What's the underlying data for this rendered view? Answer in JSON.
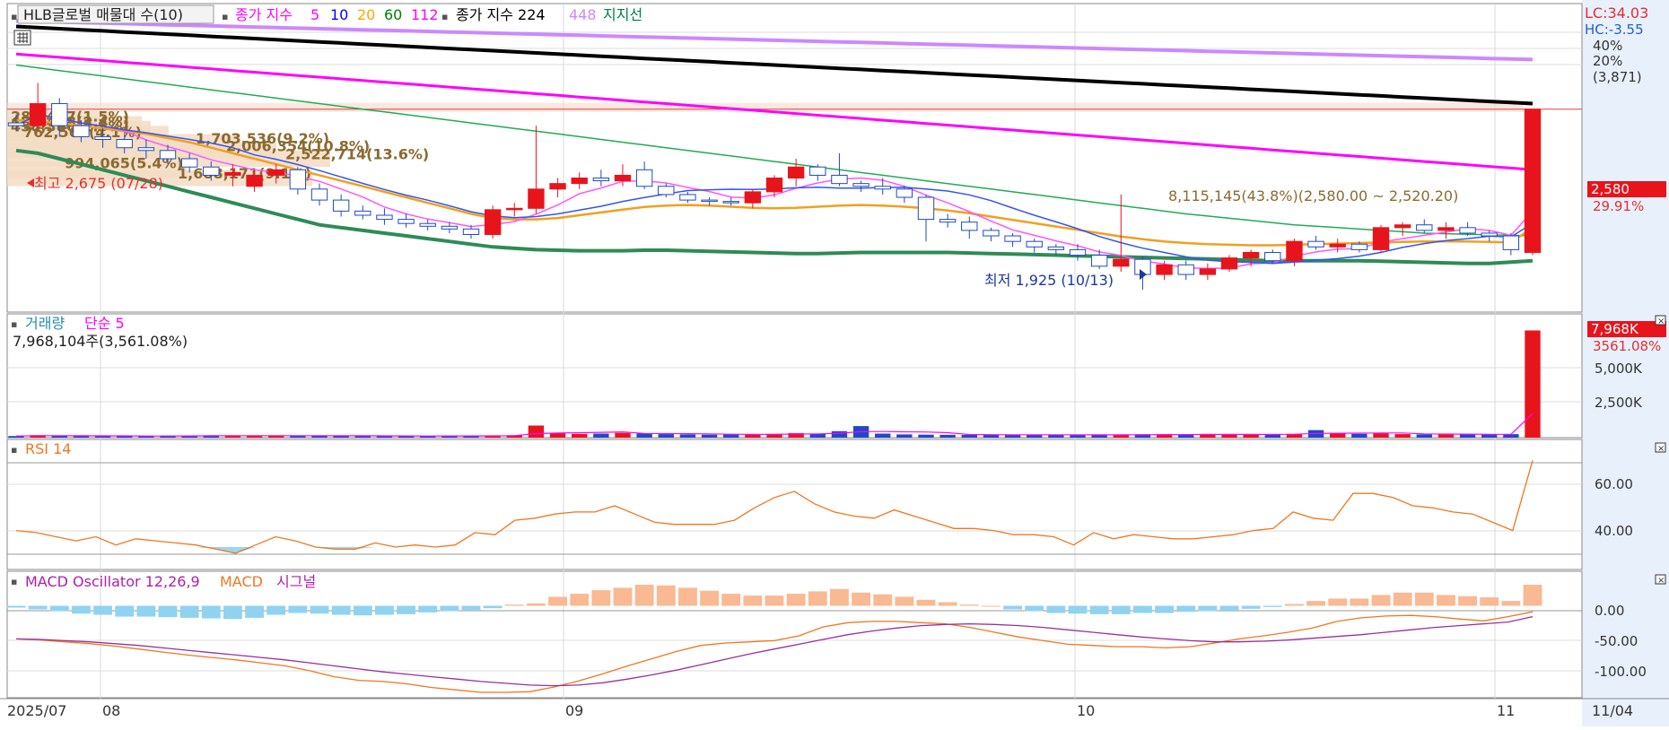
{
  "price_panel": {
    "legend": {
      "volume_profile": "HLB글로벌 매물대 수(10)",
      "ma_label": "종가 지수",
      "ma_periods": [
        "5",
        "10",
        "20",
        "60",
        "112"
      ],
      "ma_colors": [
        "#ff00ff",
        "#0000ff",
        "#ffa500",
        "#008000",
        "#ff00ff"
      ],
      "ma224_label": "종가 지수 224",
      "ma448_label": "448",
      "support_label": "지지선"
    },
    "high_marker": "최고 2,675 (07/28)",
    "low_marker": "최저 1,925 (10/13)",
    "profile_band_label": "8,115,145(43.8%)(2,580.00 ~ 2,520.20)",
    "axis_labels": [
      "LC:34.03",
      "HC:-3.55",
      "40%",
      "20%",
      "(3,871)"
    ],
    "price_badge": "2,580",
    "change_pct": "29.91%",
    "volume_profile_labels": [
      "280,447(1.5%)",
      "439,428(2.4%)",
      "458,386(2.5%)",
      "762,567(4.1%)",
      "1,703,536(9.2%)",
      "2,006,354(10.8%)",
      "2,522,714(13.6%)",
      "994,065(5.4%)",
      "1,688,171(9.1%)"
    ]
  },
  "volume_panel": {
    "legend_a": "거래량",
    "legend_b": "단순 5",
    "readout": "7,968,104주(3,561.08%)",
    "badge": "7,968K",
    "badge_pct": "3561.08%",
    "ticks": [
      "5,000K",
      "2,500K"
    ]
  },
  "rsi_panel": {
    "legend": "RSI 14",
    "ticks": [
      "60.00",
      "40.00"
    ]
  },
  "macd_panel": {
    "legend_a": "MACD Oscillator 12,26,9",
    "legend_b": "MACD",
    "legend_c": "시그널",
    "ticks": [
      "0.00",
      "-50.00",
      "-100.00"
    ]
  },
  "x_axis": {
    "labels": [
      "2025/07",
      "08",
      "09",
      "10",
      "11"
    ],
    "right_label": "11/04"
  },
  "chart_data": [
    {
      "type": "candlestick",
      "title": "HLB글로벌",
      "ylim": [
        1850,
        2950
      ],
      "candles": [
        [
          2530,
          2560,
          2500,
          2520
        ],
        [
          2520,
          2675,
          2510,
          2600
        ],
        [
          2600,
          2620,
          2480,
          2520
        ],
        [
          2520,
          2540,
          2460,
          2480
        ],
        [
          2480,
          2510,
          2440,
          2470
        ],
        [
          2470,
          2490,
          2420,
          2440
        ],
        [
          2440,
          2470,
          2400,
          2430
        ],
        [
          2430,
          2450,
          2380,
          2400
        ],
        [
          2400,
          2420,
          2350,
          2370
        ],
        [
          2370,
          2390,
          2320,
          2340
        ],
        [
          2340,
          2380,
          2300,
          2350
        ],
        [
          2300,
          2360,
          2280,
          2340
        ],
        [
          2340,
          2380,
          2310,
          2360
        ],
        [
          2360,
          2370,
          2270,
          2290
        ],
        [
          2290,
          2310,
          2230,
          2250
        ],
        [
          2250,
          2270,
          2190,
          2210
        ],
        [
          2210,
          2230,
          2180,
          2195
        ],
        [
          2195,
          2220,
          2160,
          2180
        ],
        [
          2180,
          2200,
          2150,
          2165
        ],
        [
          2165,
          2180,
          2140,
          2155
        ],
        [
          2155,
          2170,
          2130,
          2145
        ],
        [
          2145,
          2160,
          2110,
          2125
        ],
        [
          2125,
          2230,
          2110,
          2215
        ],
        [
          2215,
          2240,
          2190,
          2220
        ],
        [
          2220,
          2520,
          2200,
          2290
        ],
        [
          2290,
          2330,
          2260,
          2310
        ],
        [
          2310,
          2350,
          2290,
          2330
        ],
        [
          2330,
          2360,
          2300,
          2320
        ],
        [
          2320,
          2380,
          2300,
          2340
        ],
        [
          2360,
          2390,
          2290,
          2300
        ],
        [
          2300,
          2310,
          2260,
          2270
        ],
        [
          2270,
          2280,
          2240,
          2250
        ],
        [
          2250,
          2260,
          2230,
          2245
        ],
        [
          2245,
          2260,
          2230,
          2240
        ],
        [
          2240,
          2290,
          2220,
          2280
        ],
        [
          2280,
          2340,
          2260,
          2330
        ],
        [
          2330,
          2400,
          2300,
          2370
        ],
        [
          2370,
          2380,
          2320,
          2340
        ],
        [
          2340,
          2420,
          2300,
          2310
        ],
        [
          2310,
          2320,
          2280,
          2300
        ],
        [
          2300,
          2330,
          2270,
          2290
        ],
        [
          2290,
          2300,
          2240,
          2260
        ],
        [
          2260,
          2270,
          2100,
          2180
        ],
        [
          2180,
          2200,
          2150,
          2170
        ],
        [
          2170,
          2190,
          2110,
          2140
        ],
        [
          2140,
          2150,
          2100,
          2120
        ],
        [
          2120,
          2130,
          2080,
          2100
        ],
        [
          2100,
          2110,
          2060,
          2080
        ],
        [
          2080,
          2090,
          2050,
          2070
        ],
        [
          2070,
          2090,
          2030,
          2050
        ],
        [
          2050,
          2070,
          2000,
          2010
        ],
        [
          2010,
          2270,
          1990,
          2035
        ],
        [
          2035,
          2045,
          1925,
          1980
        ],
        [
          1980,
          2030,
          1960,
          2015
        ],
        [
          2015,
          2030,
          1960,
          1980
        ],
        [
          1980,
          2020,
          1960,
          2000
        ],
        [
          2000,
          2050,
          1990,
          2040
        ],
        [
          2040,
          2070,
          2010,
          2060
        ],
        [
          2060,
          2070,
          2020,
          2030
        ],
        [
          2030,
          2110,
          2010,
          2100
        ],
        [
          2100,
          2120,
          2070,
          2080
        ],
        [
          2080,
          2110,
          2060,
          2090
        ],
        [
          2090,
          2100,
          2060,
          2070
        ],
        [
          2070,
          2160,
          2060,
          2150
        ],
        [
          2150,
          2170,
          2120,
          2160
        ],
        [
          2160,
          2180,
          2130,
          2140
        ],
        [
          2140,
          2170,
          2110,
          2150
        ],
        [
          2150,
          2170,
          2120,
          2130
        ],
        [
          2130,
          2140,
          2100,
          2120
        ],
        [
          2120,
          2130,
          2050,
          2070
        ],
        [
          2060,
          2580,
          2050,
          2580
        ]
      ],
      "support_line": [
        2430,
        2420,
        2400,
        2380,
        2360,
        2340,
        2320,
        2300,
        2280,
        2260,
        2240,
        2220,
        2200,
        2180,
        2160,
        2150,
        2140,
        2130,
        2120,
        2110,
        2100,
        2090,
        2080,
        2075,
        2070,
        2068,
        2066,
        2066,
        2066,
        2068,
        2068,
        2066,
        2064,
        2062,
        2060,
        2058,
        2056,
        2056,
        2058,
        2060,
        2060,
        2060,
        2060,
        2060,
        2058,
        2056,
        2054,
        2052,
        2050,
        2048,
        2046,
        2044,
        2042,
        2040,
        2038,
        2036,
        2034,
        2032,
        2030,
        2030,
        2030,
        2030,
        2030,
        2028,
        2026,
        2024,
        2022,
        2020,
        2020,
        2025,
        2030
      ],
      "ma224": [
        2880,
        2876,
        2872,
        2868,
        2864,
        2860,
        2856,
        2852,
        2848,
        2844,
        2840,
        2836,
        2832,
        2828,
        2824,
        2820,
        2816,
        2812,
        2808,
        2804,
        2800,
        2796,
        2792,
        2788,
        2784,
        2780,
        2776,
        2772,
        2768,
        2764,
        2760,
        2756,
        2752,
        2748,
        2744,
        2740,
        2736,
        2732,
        2728,
        2724,
        2720,
        2716,
        2712,
        2708,
        2704,
        2700,
        2696,
        2692,
        2688,
        2684,
        2680,
        2676,
        2672,
        2668,
        2664,
        2660,
        2656,
        2652,
        2648,
        2644,
        2640,
        2636,
        2632,
        2628,
        2624,
        2620,
        2616,
        2612,
        2608,
        2604,
        2600
      ],
      "ma448": [
        2900,
        2898,
        2896,
        2894,
        2892,
        2890,
        2888,
        2886,
        2884,
        2882,
        2880,
        2878,
        2876,
        2874,
        2872,
        2870,
        2868,
        2866,
        2864,
        2862,
        2860,
        2858,
        2856,
        2854,
        2852,
        2850,
        2848,
        2846,
        2844,
        2842,
        2840,
        2838,
        2836,
        2834,
        2832,
        2830,
        2828,
        2826,
        2824,
        2822,
        2820,
        2818,
        2816,
        2814,
        2812,
        2810,
        2808,
        2806,
        2804,
        2802,
        2800,
        2798,
        2796,
        2794,
        2792,
        2790,
        2788,
        2786,
        2784,
        2782,
        2780,
        2778,
        2776,
        2774,
        2772,
        2770,
        2768,
        2766,
        2764,
        2762,
        2760
      ],
      "ma112": [
        2780,
        2774,
        2768,
        2762,
        2756,
        2750,
        2744,
        2738,
        2732,
        2726,
        2720,
        2714,
        2708,
        2702,
        2696,
        2690,
        2684,
        2678,
        2672,
        2666,
        2660,
        2654,
        2648,
        2642,
        2636,
        2630,
        2624,
        2618,
        2612,
        2606,
        2600,
        2594,
        2588,
        2582,
        2576,
        2570,
        2564,
        2558,
        2552,
        2546,
        2540,
        2534,
        2528,
        2522,
        2516,
        2510,
        2504,
        2498,
        2492,
        2486,
        2480,
        2474,
        2468,
        2462,
        2456,
        2450,
        2444,
        2438,
        2432,
        2426,
        2420,
        2414,
        2408,
        2402,
        2396,
        2390,
        2384,
        2378,
        2372,
        2366,
        2360
      ],
      "ma60": [
        2740,
        2730,
        2720,
        2710,
        2700,
        2690,
        2680,
        2670,
        2660,
        2650,
        2640,
        2630,
        2620,
        2610,
        2600,
        2590,
        2580,
        2570,
        2560,
        2550,
        2540,
        2530,
        2520,
        2510,
        2500,
        2490,
        2480,
        2470,
        2460,
        2450,
        2440,
        2430,
        2420,
        2410,
        2400,
        2390,
        2380,
        2370,
        2360,
        2350,
        2340,
        2330,
        2320,
        2310,
        2300,
        2290,
        2280,
        2270,
        2260,
        2250,
        2240,
        2230,
        2220,
        2210,
        2200,
        2192,
        2184,
        2176,
        2168,
        2160,
        2155,
        2150,
        2145,
        2140,
        2135,
        2130,
        2128,
        2126,
        2124,
        2122,
        2120
      ],
      "ma20": [
        2540,
        2535,
        2530,
        2520,
        2510,
        2500,
        2490,
        2475,
        2460,
        2440,
        2420,
        2400,
        2380,
        2360,
        2340,
        2320,
        2300,
        2280,
        2260,
        2240,
        2220,
        2200,
        2185,
        2180,
        2180,
        2185,
        2195,
        2205,
        2215,
        2225,
        2230,
        2232,
        2230,
        2226,
        2222,
        2220,
        2222,
        2226,
        2230,
        2232,
        2230,
        2226,
        2220,
        2212,
        2202,
        2190,
        2178,
        2166,
        2154,
        2142,
        2130,
        2118,
        2108,
        2100,
        2094,
        2090,
        2088,
        2086,
        2086,
        2088,
        2090,
        2092,
        2094,
        2096,
        2098,
        2100,
        2100,
        2100,
        2098,
        2096,
        2150
      ]
    },
    {
      "type": "bar",
      "title": "거래량",
      "ylim": [
        0,
        8000
      ],
      "values": [
        120,
        180,
        150,
        120,
        110,
        100,
        130,
        150,
        160,
        170,
        140,
        130,
        150,
        160,
        140,
        130,
        120,
        110,
        130,
        120,
        140,
        130,
        160,
        180,
        900,
        320,
        280,
        300,
        350,
        320,
        260,
        240,
        220,
        230,
        260,
        280,
        340,
        280,
        480,
        860,
        300,
        240,
        220,
        210,
        200,
        220,
        230,
        220,
        200,
        190,
        210,
        230,
        250,
        240,
        220,
        260,
        240,
        230,
        250,
        280,
        560,
        300,
        280,
        320,
        260,
        240,
        230,
        250,
        240,
        260,
        7968
      ],
      "ticks": [
        5000,
        2500
      ]
    },
    {
      "type": "line",
      "title": "RSI 14",
      "ylim": [
        20,
        80
      ],
      "values": [
        38,
        37,
        35,
        33,
        35,
        31,
        34,
        33,
        32,
        31,
        29,
        27,
        31,
        35,
        33,
        30,
        29,
        29,
        32,
        30,
        31,
        30,
        31,
        37,
        36,
        43,
        44,
        46,
        47,
        47,
        50,
        46,
        42,
        41,
        41,
        41,
        43,
        49,
        54,
        57,
        51,
        47,
        45,
        44,
        48,
        45,
        42,
        39,
        39,
        38,
        36,
        36,
        35,
        31,
        37,
        34,
        36,
        35,
        34,
        34,
        35,
        36,
        38,
        39,
        47,
        44,
        43,
        56,
        56,
        54,
        50,
        49,
        47,
        46,
        42,
        38,
        72
      ],
      "ticks": [
        60,
        40
      ]
    },
    {
      "type": "bar",
      "title": "MACD Oscillator 12,26,9",
      "ylim": [
        -150,
        50
      ],
      "values": [
        -3,
        -6,
        -9,
        -13,
        -15,
        -18,
        -18,
        -19,
        -20,
        -21,
        -22,
        -20,
        -15,
        -12,
        -13,
        -15,
        -16,
        -15,
        -14,
        -11,
        -9,
        -7,
        -4,
        2,
        4,
        15,
        20,
        26,
        30,
        35,
        34,
        30,
        25,
        20,
        17,
        17,
        20,
        24,
        28,
        22,
        19,
        15,
        10,
        6,
        2,
        0,
        -6,
        -9,
        -12,
        -13,
        -14,
        -14,
        -12,
        -12,
        -10,
        -9,
        -8,
        -5,
        -2,
        3,
        8,
        12,
        12,
        18,
        22,
        22,
        18,
        16,
        14,
        8,
        35
      ],
      "macd": [
        -55,
        -57,
        -60,
        -63,
        -67,
        -72,
        -77,
        -82,
        -86,
        -90,
        -95,
        -100,
        -108,
        -118,
        -124,
        -126,
        -130,
        -136,
        -140,
        -144,
        -144,
        -143,
        -135,
        -125,
        -113,
        -100,
        -88,
        -76,
        -66,
        -62,
        -60,
        -58,
        -50,
        -35,
        -28,
        -26,
        -26,
        -28,
        -30,
        -36,
        -44,
        -52,
        -58,
        -64,
        -66,
        -68,
        -68,
        -70,
        -68,
        -62,
        -55,
        -50,
        -44,
        -37,
        -26,
        -20,
        -17,
        -16,
        -18,
        -22,
        -25,
        -18,
        -10
      ],
      "signal": [
        -55,
        -56,
        -58,
        -60,
        -63,
        -66,
        -70,
        -74,
        -78,
        -82,
        -86,
        -90,
        -95,
        -100,
        -105,
        -110,
        -114,
        -118,
        -122,
        -126,
        -129,
        -132,
        -133,
        -132,
        -128,
        -122,
        -115,
        -107,
        -98,
        -89,
        -80,
        -72,
        -64,
        -56,
        -48,
        -42,
        -37,
        -33,
        -31,
        -30,
        -31,
        -33,
        -36,
        -40,
        -44,
        -48,
        -52,
        -55,
        -58,
        -60,
        -60,
        -59,
        -57,
        -54,
        -51,
        -48,
        -44,
        -40,
        -36,
        -33,
        -30,
        -27,
        -18
      ],
      "ticks": [
        0,
        -50,
        -100
      ]
    }
  ]
}
